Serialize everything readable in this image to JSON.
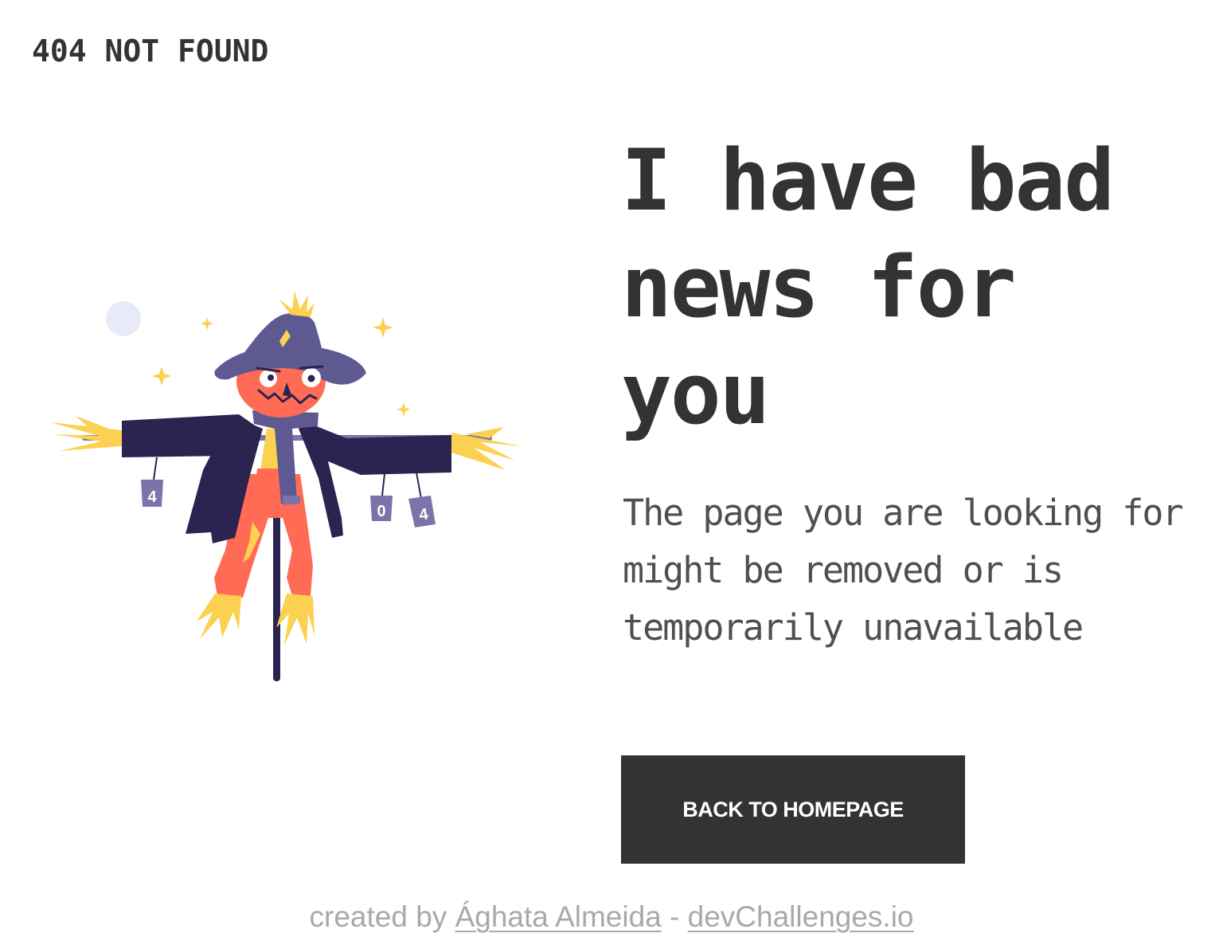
{
  "header": {
    "brand": "404 NOT FOUND"
  },
  "main": {
    "headline": "I have bad news for you",
    "description": "The page you are looking for might be removed or is temporarily unavailable",
    "button_label": "BACK TO HOMEPAGE",
    "illustration": {
      "icon": "scarecrow-illustration",
      "can_labels": [
        "4",
        "0",
        "4"
      ]
    }
  },
  "footer": {
    "prefix": "created by",
    "author": "Ághata Almeida",
    "separator": "-",
    "site": "devChallenges.io"
  },
  "colors": {
    "text": "#333333",
    "description": "#4f4f4f",
    "button_bg": "#333333",
    "button_text": "#ffffff",
    "footer_text": "#a9a9a9",
    "hat": "#5e5990",
    "coat": "#2b2450",
    "face": "#ff6b55",
    "straw": "#fcd050",
    "moon": "#e8ebf7"
  }
}
